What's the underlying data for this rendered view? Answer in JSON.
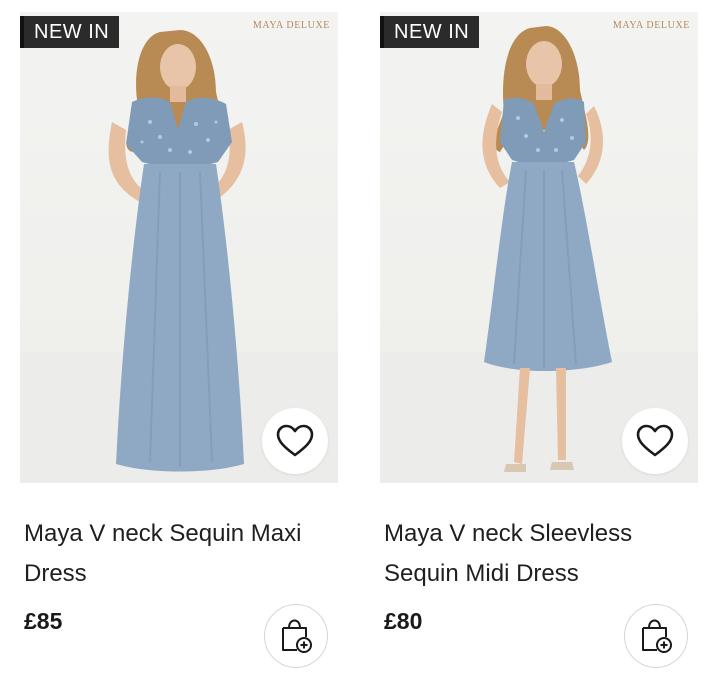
{
  "products": [
    {
      "badge": "NEW IN",
      "brand_mark": "MAYA DELUXE",
      "title": "Maya V neck Sequin Maxi Dress",
      "price": "£85",
      "wishlist_icon": "heart-icon",
      "bag_icon": "add-to-bag-icon"
    },
    {
      "badge": "NEW IN",
      "brand_mark": "MAYA DELUXE",
      "title": "Maya V neck Sleevless Sequin Midi Dress",
      "price": "£80",
      "wishlist_icon": "heart-icon",
      "bag_icon": "add-to-bag-icon"
    }
  ],
  "colors": {
    "badge_bg": "#2b2b2b",
    "dress_blue": "#8fa9c4",
    "brand_mark": "#b48a5a"
  }
}
